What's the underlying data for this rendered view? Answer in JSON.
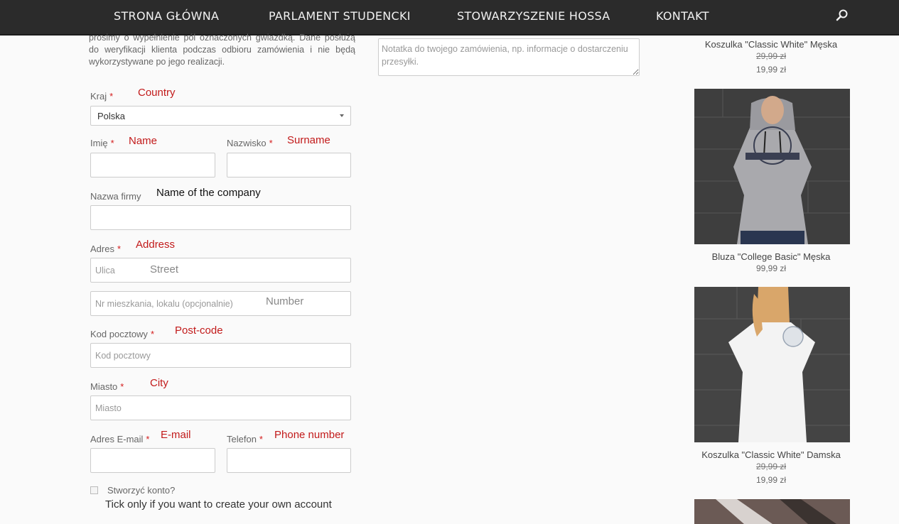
{
  "nav": {
    "items": [
      "STRONA GŁÓWNA",
      "PARLAMENT STUDENCKI",
      "STOWARZYSZENIE HOSSA",
      "KONTAKT"
    ],
    "search_icon": "search-icon"
  },
  "form": {
    "intro": "prosimy o wypełnienie pól oznaczonych gwiazdką. Dane posłużą do weryfikacji klienta podczas odbioru zamówienia i nie będą wykorzystywane po jego realizacji.",
    "required_mark": "*",
    "country": {
      "label": "Kraj",
      "annotation": "Country",
      "value": "Polska"
    },
    "first_name": {
      "label": "Imię",
      "annotation": "Name",
      "value": ""
    },
    "last_name": {
      "label": "Nazwisko",
      "annotation": "Surname",
      "value": ""
    },
    "company": {
      "label": "Nazwa firmy",
      "annotation": "Name of the company",
      "value": ""
    },
    "address": {
      "label": "Adres",
      "annotation": "Address",
      "street_placeholder": "Ulica",
      "street_annotation": "Street",
      "number_placeholder": "Nr mieszkania, lokalu (opcjonalnie)",
      "number_annotation": "Number"
    },
    "postcode": {
      "label": "Kod pocztowy",
      "annotation": "Post-code",
      "placeholder": "Kod pocztowy"
    },
    "city": {
      "label": "Miasto",
      "annotation": "City",
      "placeholder": "Miasto"
    },
    "email": {
      "label": "Adres E-mail",
      "annotation": "E-mail",
      "value": ""
    },
    "phone": {
      "label": "Telefon",
      "annotation": "Phone number",
      "value": ""
    },
    "create_account": {
      "label": "Stworzyć konto?",
      "annotation": "Tick only if you want to create your own account",
      "checked": false
    }
  },
  "notes": {
    "placeholder": "Notatka do twojego zamówienia, np. informacje o dostarczeniu przesyłki."
  },
  "products": [
    {
      "title": "Koszulka \"Classic White\" Męska",
      "old_price": "29,99 zł",
      "price": "19,99 zł"
    },
    {
      "title": "Bluza \"College Basic\" Męska",
      "old_price": "",
      "price": "99,99 zł"
    },
    {
      "title": "Koszulka \"Classic White\" Damska",
      "old_price": "29,99 zł",
      "price": "19,99 zł"
    }
  ],
  "colors": {
    "nav_bg": "#2b2b2b",
    "required": "#d41c1c",
    "annotation": "#c21a1a"
  }
}
